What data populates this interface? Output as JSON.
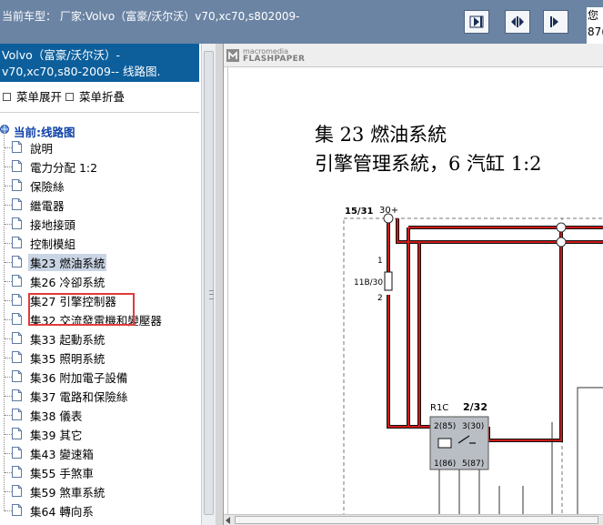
{
  "header": {
    "car_model_text": "当前车型：  厂家:Volvo（富豪/沃尔沃）v70,xc70,s802009-",
    "greeting_partial": [
      "您",
      "87("
    ],
    "buttons": [
      {
        "name": "previous-page-button",
        "icon": "arrow-left-bar-icon"
      },
      {
        "name": "fit-page-button",
        "icon": "double-arrow-icon"
      },
      {
        "name": "next-page-button",
        "icon": "arrow-right-bar-icon"
      }
    ]
  },
  "sidebar": {
    "title_line1": "Volvo（富豪/沃尔沃）-",
    "title_line2": "v70,xc70,s80-2009-- 线路图.",
    "expand_label": "菜单展开",
    "collapse_label": "菜单折叠",
    "root_label": "当前:线路图",
    "items": [
      {
        "label": "說明"
      },
      {
        "label": "電力分配 1:2"
      },
      {
        "label": "保險絲"
      },
      {
        "label": "繼電器"
      },
      {
        "label": "接地接頭"
      },
      {
        "label": "控制模組"
      },
      {
        "label": "集23 燃油系統",
        "selected": true
      },
      {
        "label": "集26 冷卻系統"
      },
      {
        "label": "集27 引擎控制器"
      },
      {
        "label": "集32 交流發電機和變壓器"
      },
      {
        "label": "集33 起動系統"
      },
      {
        "label": "集35 照明系統"
      },
      {
        "label": "集36 附加電子設備"
      },
      {
        "label": "集37 電路和保險絲"
      },
      {
        "label": "集38 儀表"
      },
      {
        "label": "集39 其它"
      },
      {
        "label": "集43 變速箱"
      },
      {
        "label": "集55 手煞車"
      },
      {
        "label": "集59 煞車系統"
      },
      {
        "label": "集64 轉向系"
      }
    ]
  },
  "viewer": {
    "logo_line1": "macromedia",
    "logo_line2": "FLASHPAPER",
    "doc_title_line1": "集 23 燃油系統",
    "doc_title_line2": "引擎管理系統，6 汽缸  1:2",
    "diagram_labels": {
      "supply": "30+",
      "fuse_ref": "15/31",
      "pin1": "1",
      "fuse_name": "11B/30",
      "pin2": "2",
      "relay_name": "R1C",
      "relay_ref": "2/32",
      "relay_pin_86": "2(85)",
      "relay_pin_30": "3(30)",
      "relay_pin_86b": "1(86)",
      "relay_pin_87": "5(87)"
    },
    "colors": {
      "wire_red": "#cc1a1a",
      "relay_fill": "#b9bdc4"
    }
  },
  "colors": {
    "header_bg": "#6b84a4",
    "sidebar_title_bg": "#0d5f9c",
    "root_label": "#1042a8",
    "highlight_box": "#e33a3a"
  }
}
